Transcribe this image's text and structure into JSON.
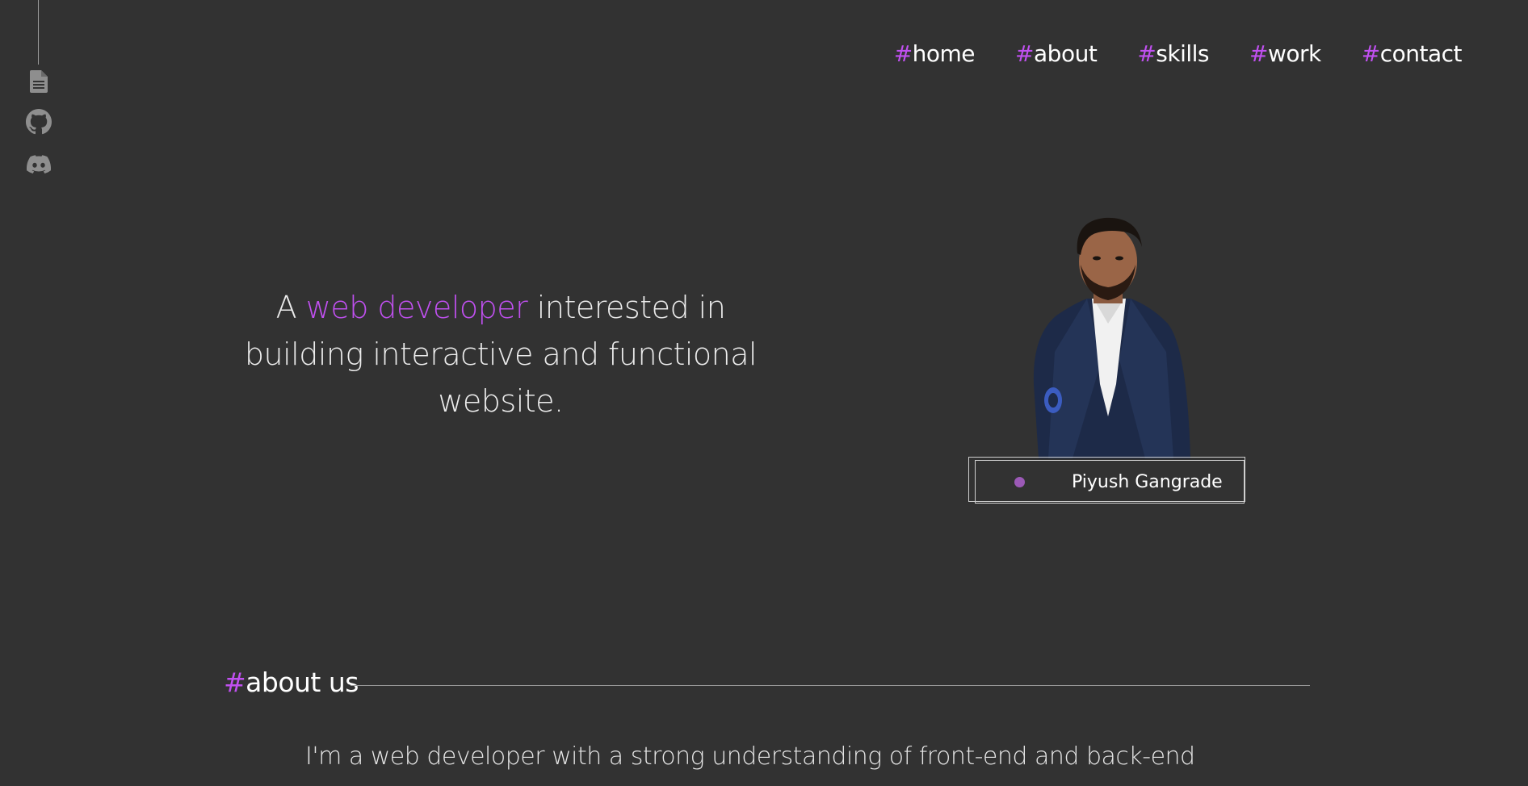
{
  "colors": {
    "background": "#323232",
    "accent": "#c050f0",
    "text": "#ffffff",
    "status_dot": "#9b59b6"
  },
  "social": {
    "items": [
      {
        "icon": "document-icon"
      },
      {
        "icon": "github-icon"
      },
      {
        "icon": "discord-icon"
      }
    ]
  },
  "nav": {
    "items": [
      {
        "hash": "#",
        "label": "home"
      },
      {
        "hash": "#",
        "label": "about"
      },
      {
        "hash": "#",
        "label": "skills"
      },
      {
        "hash": "#",
        "label": "work"
      },
      {
        "hash": "#",
        "label": "contact"
      }
    ]
  },
  "hero": {
    "prefix": "A ",
    "accent": "web developer",
    "suffix": " interested in building interactive and functional website."
  },
  "profile": {
    "name": "Piyush Gangrade"
  },
  "about": {
    "hash": "#",
    "title": "about us",
    "body": "I'm a web developer with a strong understanding of front-end and back-end"
  }
}
